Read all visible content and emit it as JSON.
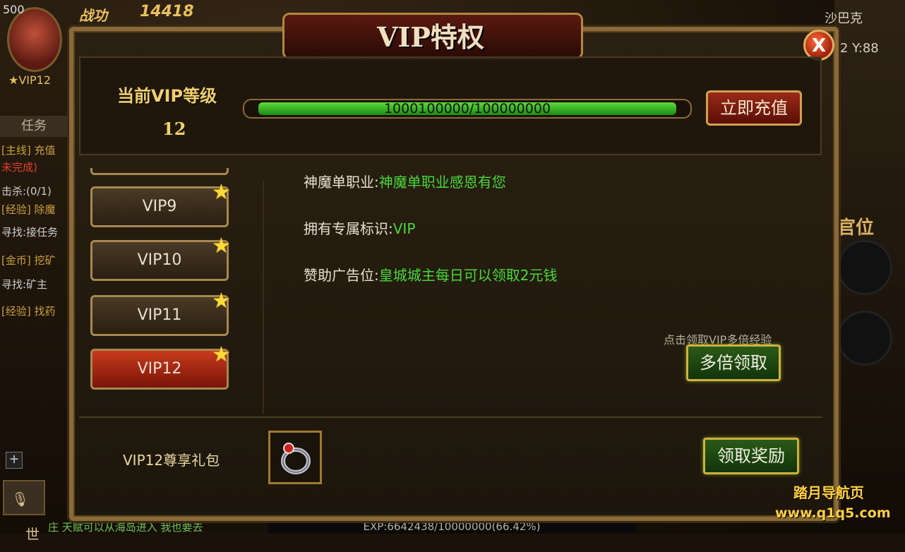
{
  "hud": {
    "level": "500",
    "power_label": "战功",
    "power_value": "14418",
    "vip_badge": "VIP12",
    "task_tab": "任务",
    "quest_lines": [
      "[主线] 充值",
      "未完成)",
      "击杀:(0/1)",
      "[经验] 除魔",
      "寻找:接任务",
      "[金币] 挖矿",
      "寻找:矿主",
      "[经验] 找药"
    ],
    "map_name": "沙巴克",
    "coords": "2 Y:88",
    "guanwei": "官位",
    "plus": "+",
    "world_btn": "世",
    "chat_line": "庄 天赋可以从海岛进入 我也要去",
    "exp_text": "EXP:6642438/10000000(66.42%)"
  },
  "watermark": {
    "line1": "踏月导航页",
    "line2": "www.q1q5.com"
  },
  "panel": {
    "title": "VIP特权",
    "close_label": "X",
    "current_label": "当前VIP等级",
    "current_level": "12",
    "progress_text": "1000100000/100000000",
    "progress_fraction": 1.0,
    "recharge_label": "立即充值",
    "vip_levels": [
      {
        "label": "VIP9",
        "active": false
      },
      {
        "label": "VIP10",
        "active": false
      },
      {
        "label": "VIP11",
        "active": false
      },
      {
        "label": "VIP12",
        "active": true
      }
    ],
    "privileges": [
      {
        "label": "神魔单职业:",
        "value": "神魔单职业感恩有您"
      },
      {
        "label": "拥有专属标识:",
        "value": "VIP"
      },
      {
        "label": "赞助广告位:",
        "value": "皇城城主每日可以领取2元钱"
      }
    ],
    "multi_hint": "点击领取VIP多倍经验",
    "multi_button": "多倍领取",
    "gift_label": "VIP12尊享礼包",
    "gift_item_icon": "ring-icon",
    "claim_button": "领取奖励"
  },
  "colors": {
    "privilege_value": "#4ad83a",
    "active_vip": "#c83a1e",
    "title_gold": "#f0d070"
  }
}
